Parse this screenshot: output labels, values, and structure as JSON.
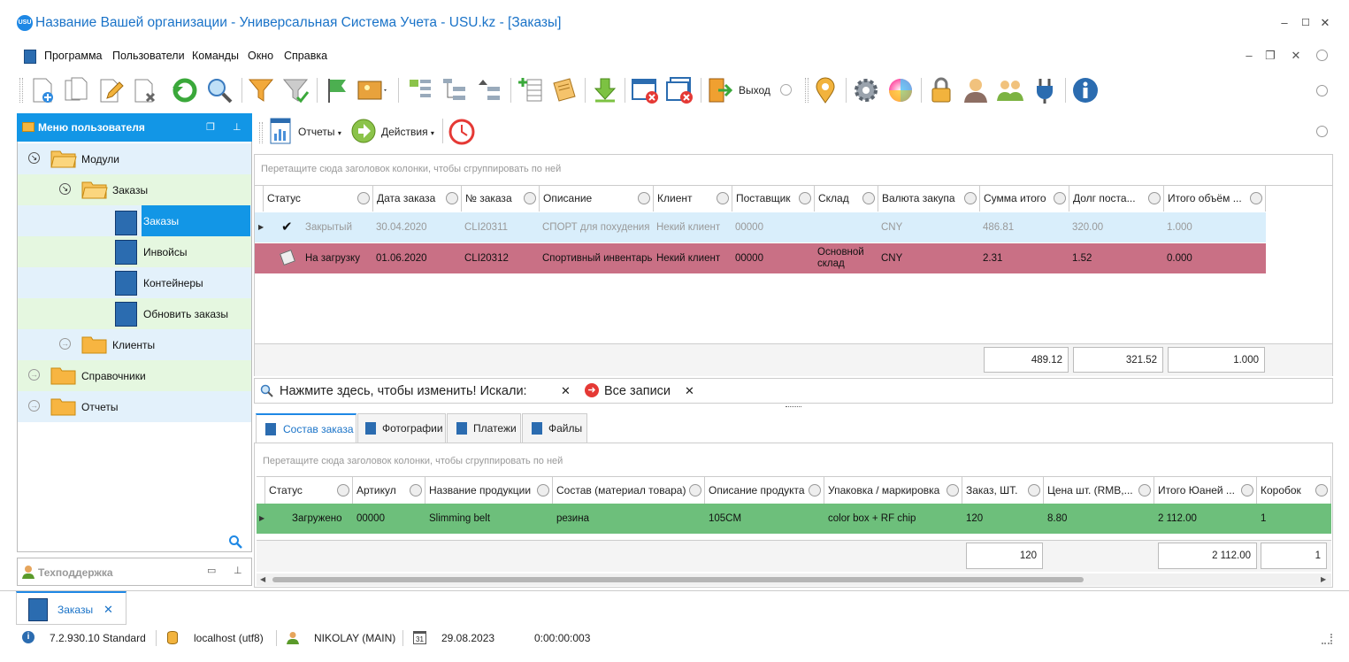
{
  "window": {
    "title": "Название Вашей организации - Универсальная Система Учета - USU.kz - [Заказы]",
    "logo_text": "USU",
    "minimize": "–",
    "maximize": "☐",
    "close": "✕"
  },
  "menu": {
    "items": [
      "Программа",
      "Пользователи",
      "Команды",
      "Окно",
      "Справка"
    ],
    "mdi_minimize": "–",
    "mdi_restore": "❐",
    "mdi_close": "✕"
  },
  "toolbar": {
    "exit_label": "Выход",
    "icons": [
      "add-icon",
      "copy-icon",
      "edit-icon",
      "delete-icon",
      "refresh-icon",
      "search-icon",
      "filter-icon",
      "filter-apply-icon",
      "flag-icon",
      "image-icon",
      "expand-icon",
      "tree-down-icon",
      "tree-up-icon",
      "add-row-icon",
      "notes-icon",
      "download-icon",
      "close-window-icon",
      "close-all-windows-icon",
      "exit-icon",
      "map-pin-icon",
      "settings-icon",
      "color-wheel-icon",
      "lock-icon",
      "user-icon",
      "users-icon",
      "plugin-icon",
      "info-icon"
    ]
  },
  "sidebar": {
    "title": "Меню пользователя",
    "items": [
      {
        "label": "Модули",
        "level": 0,
        "type": "folder",
        "expanded": true
      },
      {
        "label": "Заказы",
        "level": 1,
        "type": "folder",
        "expanded": true
      },
      {
        "label": "Заказы",
        "level": 2,
        "type": "doc",
        "selected": true
      },
      {
        "label": "Инвойсы",
        "level": 2,
        "type": "doc"
      },
      {
        "label": "Контейнеры",
        "level": 2,
        "type": "doc"
      },
      {
        "label": "Обновить заказы",
        "level": 2,
        "type": "doc"
      },
      {
        "label": "Клиенты",
        "level": 1,
        "type": "folder"
      },
      {
        "label": "Справочники",
        "level": 0,
        "type": "folder"
      },
      {
        "label": "Отчеты",
        "level": 0,
        "type": "folder"
      }
    ],
    "support_title": "Техподдержка"
  },
  "subtoolbar": {
    "reports_label": "Отчеты",
    "actions_label": "Действия"
  },
  "orders": {
    "group_hint": "Перетащите сюда заголовок колонки, чтобы сгруппировать по ней",
    "columns": [
      "Статус",
      "Дата заказа",
      "№ заказа",
      "Описание",
      "Клиент",
      "Поставщик",
      "Склад",
      "Валюта закупа",
      "Сумма итого",
      "Долг поста...",
      "Итого объём ..."
    ],
    "rows": [
      [
        "Закрытый",
        "30.04.2020",
        "CLI20311",
        "СПОРТ для похудения",
        "Некий клиент",
        "00000",
        "",
        "CNY",
        "486.81",
        "320.00",
        "1.000"
      ],
      [
        "На загрузку",
        "01.06.2020",
        "CLI20312",
        "Спортивный инвентарь",
        "Некий клиент",
        "00000",
        "Основной склад",
        "CNY",
        "2.31",
        "1.52",
        "0.000"
      ]
    ],
    "totals": [
      "489.12",
      "321.52",
      "1.000"
    ]
  },
  "filterbar": {
    "text": "Нажмите здесь, чтобы изменить! Искали:",
    "filter_value": "Все записи",
    "clear": "✕",
    "remove": "✕"
  },
  "tabs": [
    "Состав заказа",
    "Фотографии",
    "Платежи",
    "Файлы"
  ],
  "items": {
    "group_hint": "Перетащите сюда заголовок колонки, чтобы сгруппировать по ней",
    "columns": [
      "Статус",
      "Артикул",
      "Название продукции",
      "Состав (материал товара)",
      "Описание продукта",
      "Упаковка / маркировка",
      "Заказ, ШТ.",
      "Цена шт. (RMB,...",
      "Итого Юаней ...",
      "Коробок"
    ],
    "rows": [
      [
        "Загружено",
        "00000",
        "Slimming belt",
        "резина",
        "105CM",
        "color box + RF chip",
        "120",
        "8.80",
        "2 112.00",
        "1"
      ]
    ],
    "totals": [
      "120",
      "2 112.00",
      "1"
    ]
  },
  "doc_tab": {
    "label": "Заказы",
    "close": "✕"
  },
  "statusbar": {
    "version": "7.2.930.10 Standard",
    "db": "localhost (utf8)",
    "user": "NIKOLAY (MAIN)",
    "calendar_day": "31",
    "date": "29.08.2023",
    "timer": "0:00:00:003"
  }
}
